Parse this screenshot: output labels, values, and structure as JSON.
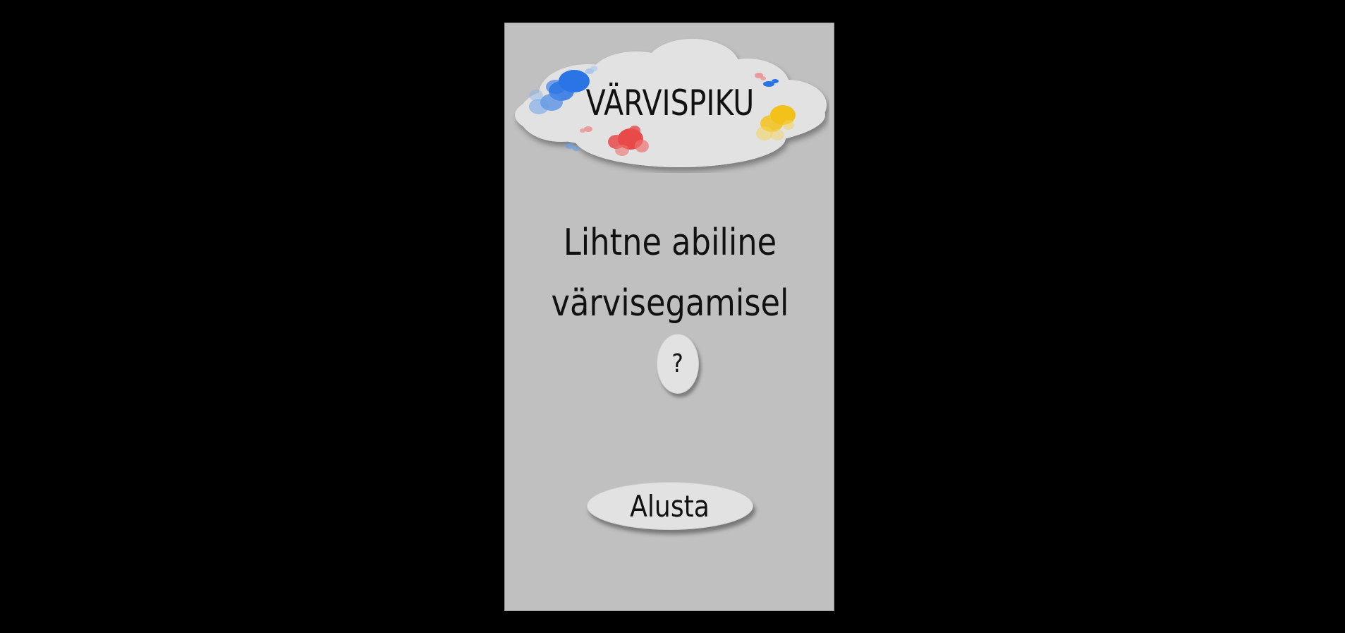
{
  "game": {
    "title": "VÄRVISPIKU",
    "subtitle": "Lihtne abiline värvisegamisel",
    "help_label": "?",
    "start_label": "Alusta"
  },
  "colors": {
    "background": "#000000",
    "panel": "#c0c0c0",
    "cloud": "#e2e2e2",
    "button": "#e2e2e2",
    "text": "#111111",
    "splash_blue": "#2a74e6",
    "splash_red": "#e84a4a",
    "splash_yellow": "#f2c21b"
  },
  "icons": {
    "cloud": "cloud-icon",
    "blue_splash": "blue-paint-splash-icon",
    "red_splash": "red-paint-splash-icon",
    "yellow_splash": "yellow-paint-splash-icon"
  }
}
